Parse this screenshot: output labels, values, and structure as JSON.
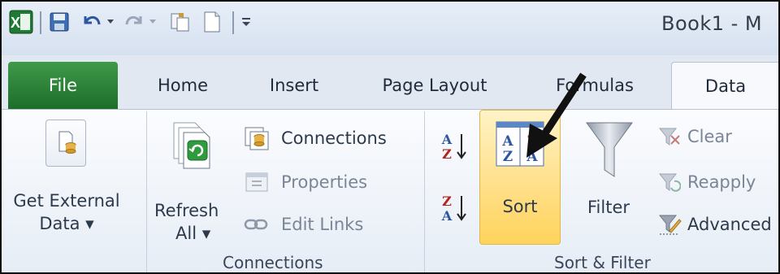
{
  "window": {
    "title": "Book1 - M"
  },
  "quick_access": {
    "icons": [
      "excel-logo-icon",
      "save-icon",
      "undo-icon",
      "redo-icon",
      "copy-icon",
      "new-document-icon",
      "customize-dropdown-icon"
    ]
  },
  "tabs": [
    {
      "label": "File"
    },
    {
      "label": "Home"
    },
    {
      "label": "Insert"
    },
    {
      "label": "Page Layout"
    },
    {
      "label": "Formulas"
    },
    {
      "label": "Data"
    }
  ],
  "ribbon": {
    "get_external_data": {
      "line1": "Get External",
      "line2": "Data ▾"
    },
    "connections_group": {
      "refresh_line1": "Refresh",
      "refresh_line2": "All ▾",
      "connections": "Connections",
      "properties": "Properties",
      "edit_links": "Edit Links",
      "label": "Connections"
    },
    "sort_filter_group": {
      "sort_az_letters": "A Z",
      "sort_za_letters": "Z A",
      "sort": "Sort",
      "filter": "Filter",
      "clear": "Clear",
      "reapply": "Reapply",
      "advanced": "Advanced",
      "label": "Sort & Filter"
    }
  },
  "colors": {
    "file_tab": "#2a7d34",
    "sort_highlight": "#ffe08b",
    "arrow": "#111111"
  }
}
